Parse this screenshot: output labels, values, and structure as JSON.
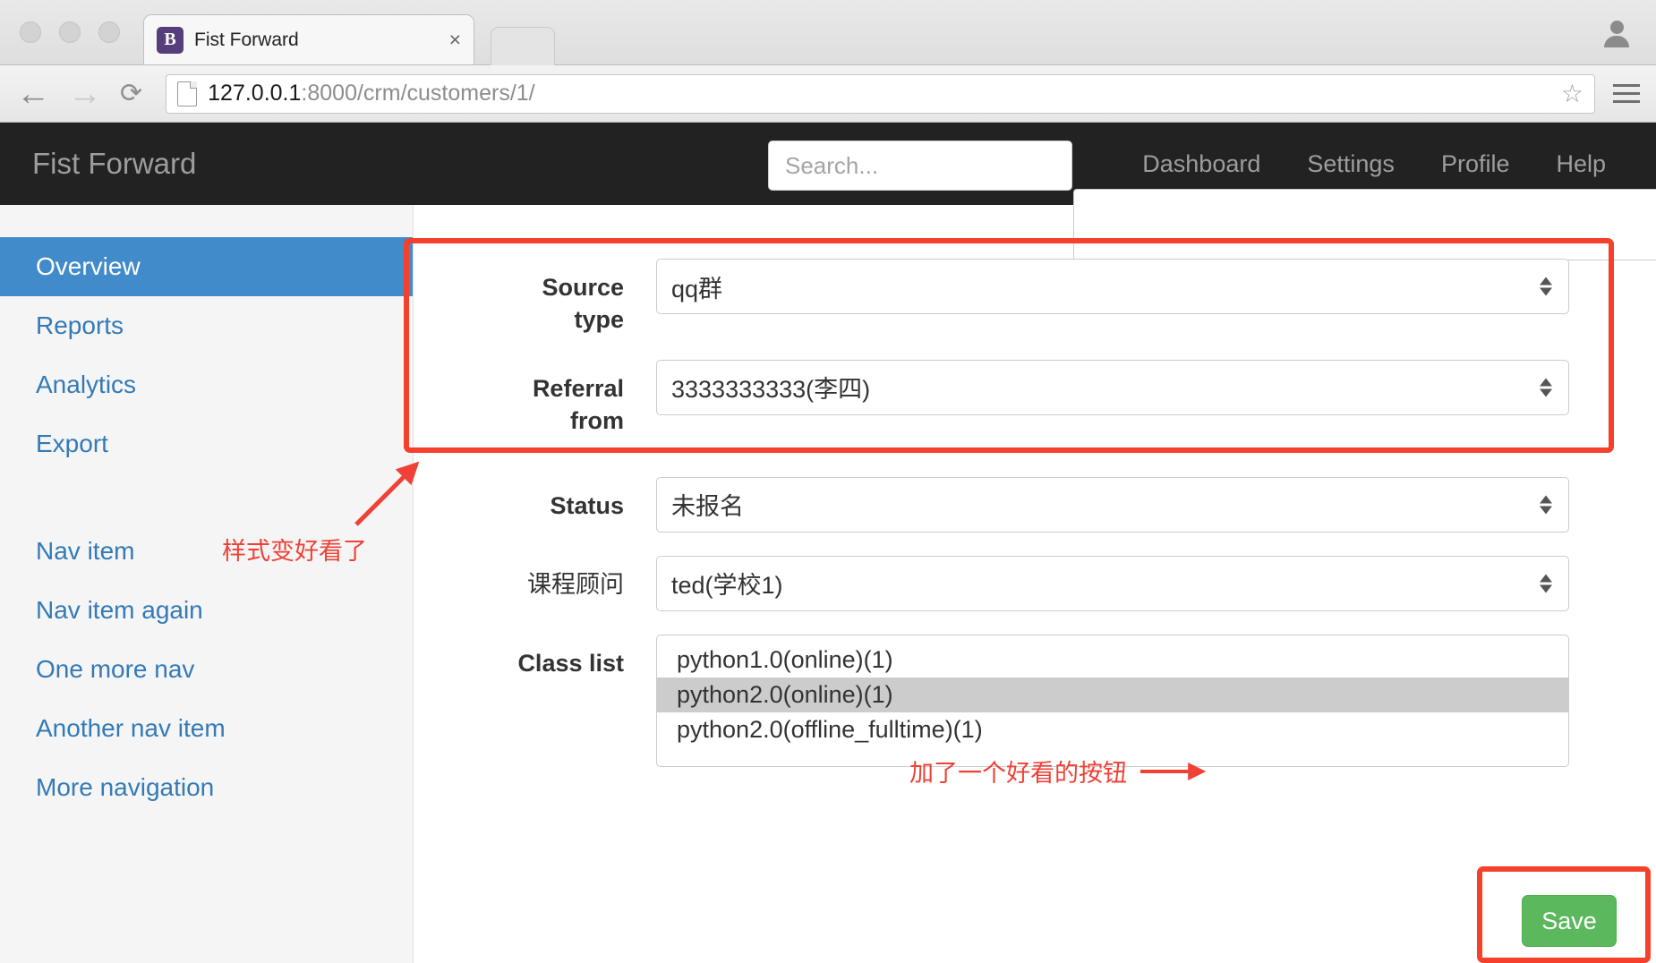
{
  "browser": {
    "tab_title": "Fist Forward",
    "favicon_letter": "B",
    "close_label": "×",
    "url_host": "127.0.0.1",
    "url_rest": ":8000/crm/customers/1/",
    "back_icon": "←",
    "forward_icon": "→",
    "reload_icon": "⟳",
    "star_icon": "☆"
  },
  "navbar": {
    "brand": "Fist Forward",
    "search_placeholder": "Search...",
    "links": [
      {
        "label": "Dashboard"
      },
      {
        "label": "Settings"
      },
      {
        "label": "Profile"
      },
      {
        "label": "Help"
      }
    ]
  },
  "sidebar": {
    "group1": [
      {
        "label": "Overview",
        "active": true
      },
      {
        "label": "Reports",
        "active": false
      },
      {
        "label": "Analytics",
        "active": false
      },
      {
        "label": "Export",
        "active": false
      }
    ],
    "group2": [
      {
        "label": "Nav item"
      },
      {
        "label": "Nav item again"
      },
      {
        "label": "One more nav"
      },
      {
        "label": "Another nav item"
      },
      {
        "label": "More navigation"
      }
    ]
  },
  "form": {
    "source_type": {
      "label_line1": "Source",
      "label_line2": "type",
      "value": "qq群"
    },
    "referral_from": {
      "label_line1": "Referral",
      "label_line2": "from",
      "value": "3333333333(李四)"
    },
    "status": {
      "label": "Status",
      "value": "未报名"
    },
    "consultant": {
      "label": "课程顾问",
      "value": "ted(学校1)"
    },
    "class_list": {
      "label": "Class list",
      "options": [
        {
          "label": "python1.0(online)(1)",
          "selected": false
        },
        {
          "label": "python2.0(online)(1)",
          "selected": true
        },
        {
          "label": "python2.0(offline_fulltime)(1)",
          "selected": false
        }
      ]
    },
    "save_label": "Save"
  },
  "annotations": {
    "style_note": "样式变好看了",
    "save_note": "加了一个好看的按钮"
  },
  "colors": {
    "annotation_red": "#ef4136",
    "box_red": "#f5402c",
    "sidebar_active": "#428bca",
    "link_blue": "#337ab7",
    "navbar_dark": "#222222",
    "save_green": "#5cb85c"
  }
}
